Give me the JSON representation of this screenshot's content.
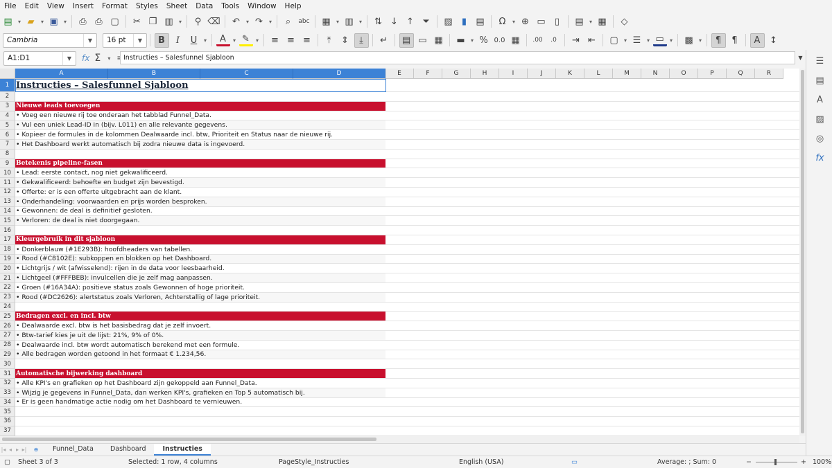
{
  "menu": [
    "File",
    "Edit",
    "View",
    "Insert",
    "Format",
    "Styles",
    "Sheet",
    "Data",
    "Tools",
    "Window",
    "Help"
  ],
  "toolbar2": {
    "font_name": "Cambria",
    "font_size": "16 pt"
  },
  "formula": {
    "name_box": "A1:D1",
    "content": "Instructies – Salesfunnel Sjabloon"
  },
  "columns": [
    {
      "label": "A",
      "sel": true
    },
    {
      "label": "B",
      "sel": true
    },
    {
      "label": "C",
      "sel": true
    },
    {
      "label": "D",
      "sel": true
    },
    {
      "label": "E"
    },
    {
      "label": "F"
    },
    {
      "label": "G"
    },
    {
      "label": "H"
    },
    {
      "label": "I"
    },
    {
      "label": "J"
    },
    {
      "label": "K"
    },
    {
      "label": "L"
    },
    {
      "label": "M"
    },
    {
      "label": "N"
    },
    {
      "label": "O"
    },
    {
      "label": "P"
    },
    {
      "label": "Q"
    },
    {
      "label": "R"
    }
  ],
  "rows": [
    {
      "n": "1",
      "type": "title",
      "text": "Instructies – Salesfunnel Sjabloon"
    },
    {
      "n": "2",
      "type": "blank",
      "text": ""
    },
    {
      "n": "3",
      "type": "section",
      "text": "Nieuwe leads toevoegen"
    },
    {
      "n": "4",
      "type": "item",
      "text": "• Voeg een nieuwe rij toe onderaan het tabblad Funnel_Data."
    },
    {
      "n": "5",
      "type": "item",
      "text": "• Vul een uniek Lead-ID in (bijv. L011) en alle relevante gegevens."
    },
    {
      "n": "6",
      "type": "item",
      "text": "• Kopieer de formules in de kolommen Dealwaarde incl. btw, Prioriteit en Status naar de nieuwe rij."
    },
    {
      "n": "7",
      "type": "item",
      "text": "• Het Dashboard werkt automatisch bij zodra nieuwe data is ingevoerd."
    },
    {
      "n": "8",
      "type": "blank",
      "text": ""
    },
    {
      "n": "9",
      "type": "section",
      "text": "Betekenis pipeline-fasen"
    },
    {
      "n": "10",
      "type": "item",
      "text": "• Lead: eerste contact, nog niet gekwalificeerd."
    },
    {
      "n": "11",
      "type": "item",
      "text": "• Gekwalificeerd: behoefte en budget zijn bevestigd."
    },
    {
      "n": "12",
      "type": "item",
      "text": "• Offerte: er is een offerte uitgebracht aan de klant."
    },
    {
      "n": "13",
      "type": "item",
      "text": "• Onderhandeling: voorwaarden en prijs worden besproken."
    },
    {
      "n": "14",
      "type": "item",
      "text": "• Gewonnen: de deal is definitief gesloten."
    },
    {
      "n": "15",
      "type": "item",
      "text": "• Verloren: de deal is niet doorgegaan."
    },
    {
      "n": "16",
      "type": "blank",
      "text": ""
    },
    {
      "n": "17",
      "type": "section",
      "text": "Kleurgebruik in dit sjabloon"
    },
    {
      "n": "18",
      "type": "item",
      "text": "• Donkerblauw (#1E293B): hoofdheaders van tabellen."
    },
    {
      "n": "19",
      "type": "item",
      "text": "• Rood (#C8102E): subkoppen en blokken op het Dashboard."
    },
    {
      "n": "20",
      "type": "item",
      "text": "• Lichtgrijs / wit (afwisselend): rijen in de data voor leesbaarheid."
    },
    {
      "n": "21",
      "type": "item",
      "text": "• Lichtgeel (#FFFBEB): invulcellen die je zelf mag aanpassen."
    },
    {
      "n": "22",
      "type": "item",
      "text": "• Groen (#16A34A): positieve status zoals Gewonnen of hoge prioriteit."
    },
    {
      "n": "23",
      "type": "item",
      "text": "• Rood (#DC2626): alertstatus zoals Verloren, Achterstallig of lage prioriteit."
    },
    {
      "n": "24",
      "type": "blank",
      "text": ""
    },
    {
      "n": "25",
      "type": "section",
      "text": "Bedragen excl. en incl. btw"
    },
    {
      "n": "26",
      "type": "item",
      "text": "• Dealwaarde excl. btw is het basisbedrag dat je zelf invoert."
    },
    {
      "n": "27",
      "type": "item",
      "text": "• Btw-tarief kies je uit de lijst: 21%, 9% of 0%."
    },
    {
      "n": "28",
      "type": "item",
      "text": "• Dealwaarde incl. btw wordt automatisch berekend met een formule."
    },
    {
      "n": "29",
      "type": "item",
      "text": "• Alle bedragen worden getoond in het formaat € 1.234,56."
    },
    {
      "n": "30",
      "type": "blank",
      "text": ""
    },
    {
      "n": "31",
      "type": "section",
      "text": "Automatische bijwerking dashboard"
    },
    {
      "n": "32",
      "type": "item",
      "text": "• Alle KPI's en grafieken op het Dashboard zijn gekoppeld aan Funnel_Data."
    },
    {
      "n": "33",
      "type": "item",
      "text": "• Wijzig je gegevens in Funnel_Data, dan werken KPI's, grafieken en Top 5 automatisch bij."
    },
    {
      "n": "34",
      "type": "item",
      "text": "• Er is geen handmatige actie nodig om het Dashboard te vernieuwen."
    },
    {
      "n": "35",
      "type": "blank",
      "text": ""
    },
    {
      "n": "36",
      "type": "blank",
      "text": ""
    },
    {
      "n": "37",
      "type": "blank",
      "text": ""
    }
  ],
  "tabs": [
    {
      "label": "Funnel_Data",
      "active": false
    },
    {
      "label": "Dashboard",
      "active": false
    },
    {
      "label": "Instructies",
      "active": true
    }
  ],
  "status": {
    "sheet": "Sheet 3 of 3",
    "selection": "Selected: 1 row, 4 columns",
    "page_style": "PageStyle_Instructies",
    "language": "English (USA)",
    "summary": "Average: ; Sum: 0",
    "zoom": "100%"
  },
  "colors": {
    "section_red": "#C8102E",
    "title_navy": "#1E293B",
    "selection_blue": "#3c82d6"
  }
}
